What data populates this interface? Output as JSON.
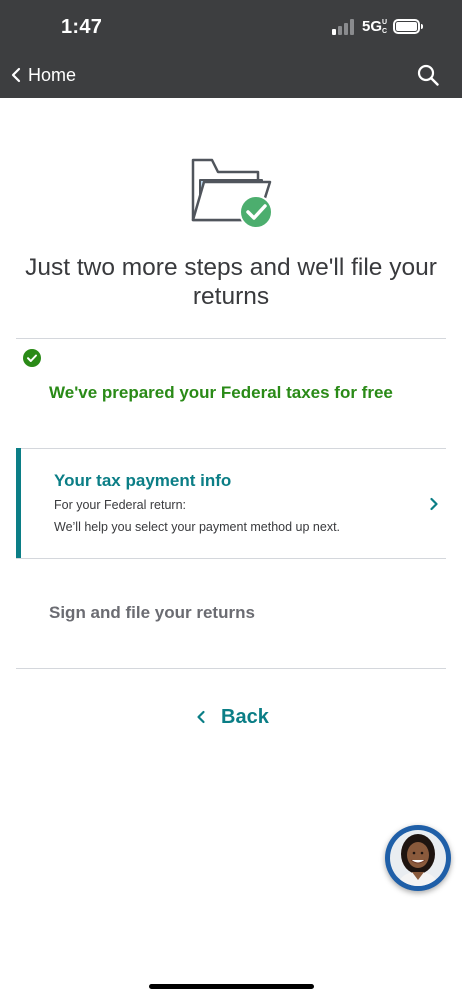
{
  "status_bar": {
    "time": "1:47",
    "network": "5G",
    "network_suffix": "UC"
  },
  "nav": {
    "back_label": "Home",
    "back_icon": "chevron-left-icon",
    "search_icon": "search-icon"
  },
  "hero": {
    "icon": "folder-check-icon",
    "headline": "Just two more steps and we'll file your returns"
  },
  "steps": {
    "completed": {
      "icon": "check-circle-icon",
      "label": "We've prepared your Federal taxes for free"
    },
    "current": {
      "title": "Your tax payment info",
      "subtitle": "For your Federal return:",
      "description": "We’ll help you select your payment method up next.",
      "icon": "chevron-right-icon"
    },
    "upcoming": {
      "label": "Sign and file your returns"
    }
  },
  "back_link": {
    "label": "Back",
    "icon": "chevron-left-icon"
  },
  "assistant": {
    "icon": "assistant-avatar"
  },
  "colors": {
    "top_bar": "#3d3e40",
    "accent_teal": "#0b7e86",
    "success_green": "#2a8a17",
    "text_dark": "#393a3d",
    "text_muted": "#6b6c72",
    "divider": "#d4d7dc"
  }
}
